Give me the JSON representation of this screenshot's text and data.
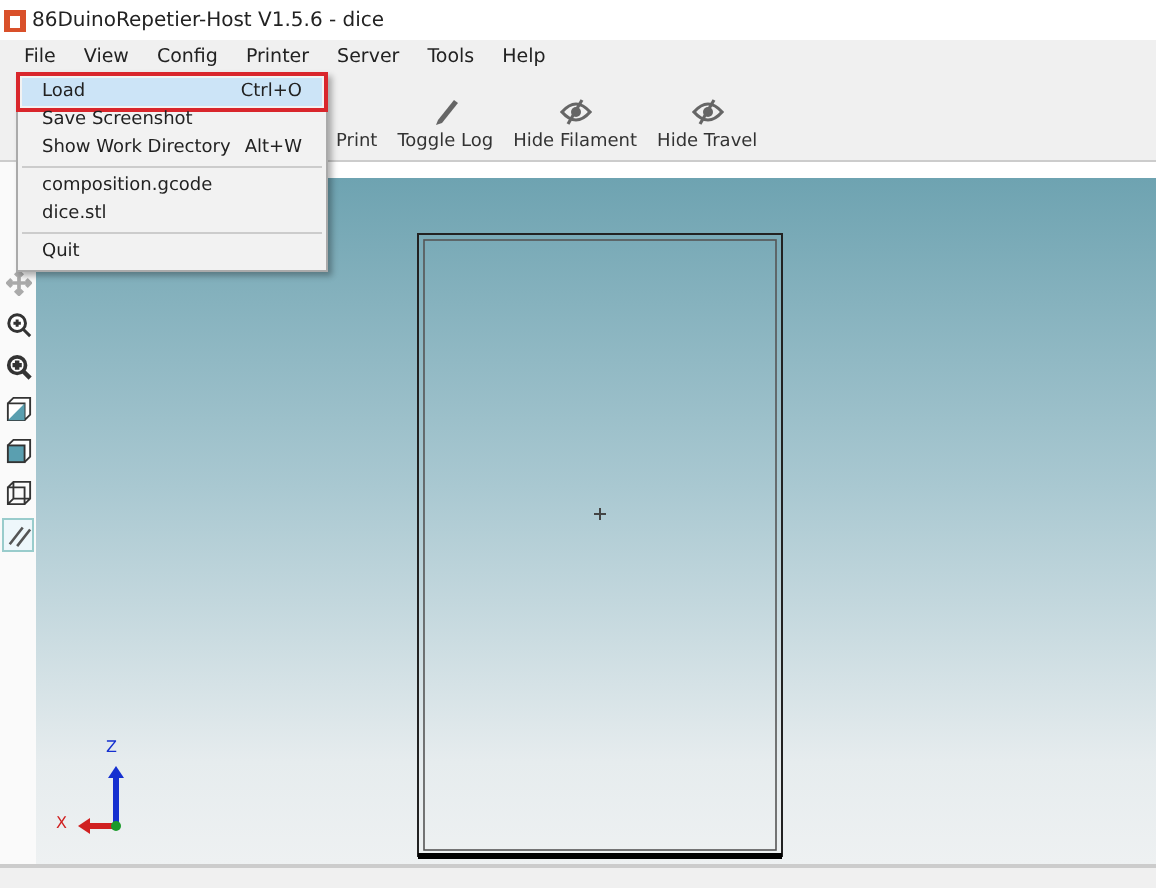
{
  "window": {
    "title": "86DuinoRepetier-Host V1.5.6 - dice"
  },
  "menu_bar": [
    "File",
    "View",
    "Config",
    "Printer",
    "Server",
    "Tools",
    "Help"
  ],
  "file_menu": {
    "items": [
      {
        "kind": "entry",
        "label": "Load",
        "shortcut": "Ctrl+O",
        "selected": true
      },
      {
        "kind": "entry",
        "label": "Save Screenshot",
        "selected": false
      },
      {
        "kind": "entry",
        "label": "Show Work Directory",
        "shortcut": "Alt+W",
        "selected": false
      },
      {
        "kind": "separator"
      },
      {
        "kind": "entry",
        "label": "composition.gcode",
        "selected": false
      },
      {
        "kind": "entry",
        "label": "dice.stl",
        "selected": false
      },
      {
        "kind": "separator"
      },
      {
        "kind": "entry",
        "label": "Quit",
        "selected": false
      }
    ]
  },
  "toolbar": [
    {
      "kind": "text",
      "label": "Print"
    },
    {
      "kind": "pencil",
      "label": "Toggle Log"
    },
    {
      "kind": "eye",
      "label": "Hide Filament"
    },
    {
      "kind": "eye",
      "label": "Hide Travel"
    }
  ],
  "side_tools": [
    {
      "kind": "move",
      "selected": false
    },
    {
      "kind": "zoom-in",
      "selected": false
    },
    {
      "kind": "zoom-fit",
      "selected": false
    },
    {
      "kind": "cube-half",
      "selected": false
    },
    {
      "kind": "cube-solid",
      "selected": false
    },
    {
      "kind": "cube-wire",
      "selected": false
    },
    {
      "kind": "parallel",
      "selected": true
    }
  ],
  "axes": {
    "x": "X",
    "z": "Z"
  }
}
